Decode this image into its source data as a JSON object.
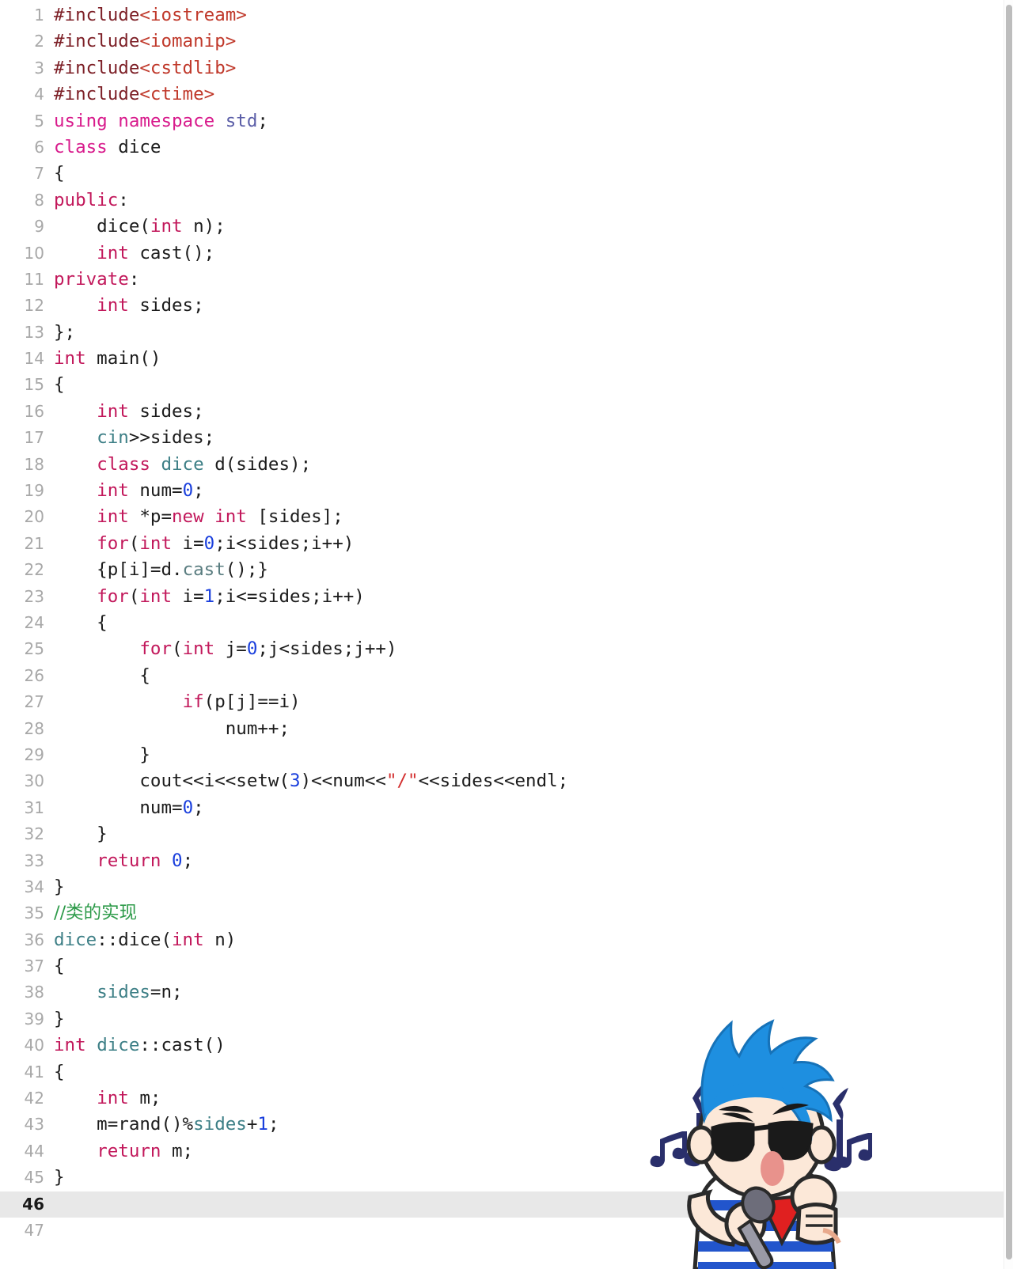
{
  "editor": {
    "language": "C++",
    "active_line": 46,
    "total_visible_lines": 47,
    "colors": {
      "background": "#ffffff",
      "active_line_bg": "#e8e8e8",
      "gutter_text": "#a8a8a8",
      "preprocessor": "#7d2027",
      "header_name": "#c0392b",
      "keyword": "#c2185b",
      "keyword_using": "#d81b8c",
      "type_name": "#3d7f86",
      "namespace": "#5c5fa8",
      "number": "#1a3fdd",
      "string": "#d32f2f",
      "comment": "#2e9b4a",
      "plain_text": "#1c1c1c",
      "scrollbar_thumb": "#bdbdbd"
    }
  },
  "scrollbar": {
    "name": "vertical-scrollbar",
    "orientation": "vertical",
    "position_percent": 0
  },
  "mascot": {
    "name": "cartoon-singer-overlay",
    "description": "blue pompadour boy with sunglasses singing into microphone",
    "hair_color": "#1e8fe0",
    "shirt_stripe_color": "#2255cc",
    "bandana_color": "#e02020",
    "note_color": "#2a2f6b",
    "skin_color": "#fce8d8"
  },
  "code": {
    "lines": [
      {
        "n": "1",
        "tokens": [
          {
            "c": "t-pre",
            "t": "#include"
          },
          {
            "c": "t-header",
            "t": "<iostream>"
          }
        ]
      },
      {
        "n": "2",
        "tokens": [
          {
            "c": "t-pre",
            "t": "#include"
          },
          {
            "c": "t-header",
            "t": "<iomanip>"
          }
        ]
      },
      {
        "n": "3",
        "tokens": [
          {
            "c": "t-pre",
            "t": "#include"
          },
          {
            "c": "t-header",
            "t": "<cstdlib>"
          }
        ]
      },
      {
        "n": "4",
        "tokens": [
          {
            "c": "t-pre",
            "t": "#include"
          },
          {
            "c": "t-header",
            "t": "<ctime>"
          }
        ]
      },
      {
        "n": "5",
        "tokens": [
          {
            "c": "t-kw2",
            "t": "using namespace "
          },
          {
            "c": "t-ns",
            "t": "std"
          },
          {
            "c": "t-plain",
            "t": ";"
          }
        ]
      },
      {
        "n": "6",
        "tokens": [
          {
            "c": "t-kw2",
            "t": "class"
          },
          {
            "c": "t-plain",
            "t": " dice"
          }
        ]
      },
      {
        "n": "7",
        "tokens": [
          {
            "c": "t-plain",
            "t": "{"
          }
        ]
      },
      {
        "n": "8",
        "tokens": [
          {
            "c": "t-kw",
            "t": "public"
          },
          {
            "c": "t-plain",
            "t": ":"
          }
        ]
      },
      {
        "n": "9",
        "tokens": [
          {
            "c": "t-plain",
            "t": "    dice("
          },
          {
            "c": "t-kw",
            "t": "int"
          },
          {
            "c": "t-plain",
            "t": " n);"
          }
        ]
      },
      {
        "n": "10",
        "tokens": [
          {
            "c": "t-plain",
            "t": "    "
          },
          {
            "c": "t-kw",
            "t": "int"
          },
          {
            "c": "t-plain",
            "t": " cast();"
          }
        ]
      },
      {
        "n": "11",
        "tokens": [
          {
            "c": "t-kw",
            "t": "private"
          },
          {
            "c": "t-plain",
            "t": ":"
          }
        ]
      },
      {
        "n": "12",
        "tokens": [
          {
            "c": "t-plain",
            "t": "    "
          },
          {
            "c": "t-kw",
            "t": "int"
          },
          {
            "c": "t-plain",
            "t": " sides;"
          }
        ]
      },
      {
        "n": "13",
        "tokens": [
          {
            "c": "t-plain",
            "t": "};"
          }
        ]
      },
      {
        "n": "14",
        "tokens": [
          {
            "c": "t-kw",
            "t": "int"
          },
          {
            "c": "t-plain",
            "t": " main()"
          }
        ]
      },
      {
        "n": "15",
        "tokens": [
          {
            "c": "t-plain",
            "t": "{"
          }
        ]
      },
      {
        "n": "16",
        "tokens": [
          {
            "c": "t-plain",
            "t": "    "
          },
          {
            "c": "t-kw",
            "t": "int"
          },
          {
            "c": "t-plain",
            "t": " sides;"
          }
        ]
      },
      {
        "n": "17",
        "tokens": [
          {
            "c": "t-plain",
            "t": "    "
          },
          {
            "c": "t-type",
            "t": "cin"
          },
          {
            "c": "t-plain",
            "t": ">>sides;"
          }
        ]
      },
      {
        "n": "18",
        "tokens": [
          {
            "c": "t-plain",
            "t": "    "
          },
          {
            "c": "t-kw",
            "t": "class"
          },
          {
            "c": "t-plain",
            "t": " "
          },
          {
            "c": "t-type",
            "t": "dice"
          },
          {
            "c": "t-plain",
            "t": " d(sides);"
          }
        ]
      },
      {
        "n": "19",
        "tokens": [
          {
            "c": "t-plain",
            "t": "    "
          },
          {
            "c": "t-kw",
            "t": "int"
          },
          {
            "c": "t-plain",
            "t": " num="
          },
          {
            "c": "t-num",
            "t": "0"
          },
          {
            "c": "t-plain",
            "t": ";"
          }
        ]
      },
      {
        "n": "20",
        "tokens": [
          {
            "c": "t-plain",
            "t": "    "
          },
          {
            "c": "t-kw",
            "t": "int"
          },
          {
            "c": "t-plain",
            "t": " *p="
          },
          {
            "c": "t-kw",
            "t": "new"
          },
          {
            "c": "t-plain",
            "t": " "
          },
          {
            "c": "t-kw",
            "t": "int"
          },
          {
            "c": "t-plain",
            "t": " [sides];"
          }
        ]
      },
      {
        "n": "21",
        "tokens": [
          {
            "c": "t-plain",
            "t": "    "
          },
          {
            "c": "t-kw",
            "t": "for"
          },
          {
            "c": "t-plain",
            "t": "("
          },
          {
            "c": "t-kw",
            "t": "int"
          },
          {
            "c": "t-plain",
            "t": " i="
          },
          {
            "c": "t-num",
            "t": "0"
          },
          {
            "c": "t-plain",
            "t": ";i<sides;i++)"
          }
        ]
      },
      {
        "n": "22",
        "tokens": [
          {
            "c": "t-plain",
            "t": "    {p[i]=d."
          },
          {
            "c": "t-fn",
            "t": "cast"
          },
          {
            "c": "t-plain",
            "t": "();}"
          }
        ]
      },
      {
        "n": "23",
        "tokens": [
          {
            "c": "t-plain",
            "t": "    "
          },
          {
            "c": "t-kw",
            "t": "for"
          },
          {
            "c": "t-plain",
            "t": "("
          },
          {
            "c": "t-kw",
            "t": "int"
          },
          {
            "c": "t-plain",
            "t": " i="
          },
          {
            "c": "t-num",
            "t": "1"
          },
          {
            "c": "t-plain",
            "t": ";i<=sides;i++)"
          }
        ]
      },
      {
        "n": "24",
        "tokens": [
          {
            "c": "t-plain",
            "t": "    {"
          }
        ]
      },
      {
        "n": "25",
        "tokens": [
          {
            "c": "t-plain",
            "t": "        "
          },
          {
            "c": "t-kw",
            "t": "for"
          },
          {
            "c": "t-plain",
            "t": "("
          },
          {
            "c": "t-kw",
            "t": "int"
          },
          {
            "c": "t-plain",
            "t": " j="
          },
          {
            "c": "t-num",
            "t": "0"
          },
          {
            "c": "t-plain",
            "t": ";j<sides;j++)"
          }
        ]
      },
      {
        "n": "26",
        "tokens": [
          {
            "c": "t-plain",
            "t": "        {"
          }
        ]
      },
      {
        "n": "27",
        "tokens": [
          {
            "c": "t-plain",
            "t": "            "
          },
          {
            "c": "t-kw",
            "t": "if"
          },
          {
            "c": "t-plain",
            "t": "(p[j]==i)"
          }
        ]
      },
      {
        "n": "28",
        "tokens": [
          {
            "c": "t-plain",
            "t": "                num++;"
          }
        ]
      },
      {
        "n": "29",
        "tokens": [
          {
            "c": "t-plain",
            "t": "        }"
          }
        ]
      },
      {
        "n": "30",
        "tokens": [
          {
            "c": "t-plain",
            "t": "        cout<<i<<setw("
          },
          {
            "c": "t-num",
            "t": "3"
          },
          {
            "c": "t-plain",
            "t": ")<<num<<"
          },
          {
            "c": "t-str",
            "t": "\"/\""
          },
          {
            "c": "t-plain",
            "t": "<<sides<<endl;"
          }
        ]
      },
      {
        "n": "31",
        "tokens": [
          {
            "c": "t-plain",
            "t": "        num="
          },
          {
            "c": "t-num",
            "t": "0"
          },
          {
            "c": "t-plain",
            "t": ";"
          }
        ]
      },
      {
        "n": "32",
        "tokens": [
          {
            "c": "t-plain",
            "t": "    }"
          }
        ]
      },
      {
        "n": "33",
        "tokens": [
          {
            "c": "t-plain",
            "t": "    "
          },
          {
            "c": "t-kw",
            "t": "return"
          },
          {
            "c": "t-plain",
            "t": " "
          },
          {
            "c": "t-num",
            "t": "0"
          },
          {
            "c": "t-plain",
            "t": ";"
          }
        ]
      },
      {
        "n": "34",
        "tokens": [
          {
            "c": "t-plain",
            "t": "}"
          }
        ]
      },
      {
        "n": "35",
        "tokens": [
          {
            "c": "t-cmt cjk",
            "t": "//类的实现"
          }
        ]
      },
      {
        "n": "36",
        "tokens": [
          {
            "c": "t-type",
            "t": "dice"
          },
          {
            "c": "t-plain",
            "t": "::dice("
          },
          {
            "c": "t-kw",
            "t": "int"
          },
          {
            "c": "t-plain",
            "t": " n)"
          }
        ]
      },
      {
        "n": "37",
        "tokens": [
          {
            "c": "t-plain",
            "t": "{"
          }
        ]
      },
      {
        "n": "38",
        "tokens": [
          {
            "c": "t-plain",
            "t": "    "
          },
          {
            "c": "t-type",
            "t": "sides"
          },
          {
            "c": "t-plain",
            "t": "=n;"
          }
        ]
      },
      {
        "n": "39",
        "tokens": [
          {
            "c": "t-plain",
            "t": "}"
          }
        ]
      },
      {
        "n": "40",
        "tokens": [
          {
            "c": "t-kw",
            "t": "int"
          },
          {
            "c": "t-plain",
            "t": " "
          },
          {
            "c": "t-type",
            "t": "dice"
          },
          {
            "c": "t-plain",
            "t": "::cast()"
          }
        ]
      },
      {
        "n": "41",
        "tokens": [
          {
            "c": "t-plain",
            "t": "{"
          }
        ]
      },
      {
        "n": "42",
        "tokens": [
          {
            "c": "t-plain",
            "t": "    "
          },
          {
            "c": "t-kw",
            "t": "int"
          },
          {
            "c": "t-plain",
            "t": " m;"
          }
        ]
      },
      {
        "n": "43",
        "tokens": [
          {
            "c": "t-plain",
            "t": "    m=rand()%"
          },
          {
            "c": "t-type",
            "t": "sides"
          },
          {
            "c": "t-plain",
            "t": "+"
          },
          {
            "c": "t-num",
            "t": "1"
          },
          {
            "c": "t-plain",
            "t": ";"
          }
        ]
      },
      {
        "n": "44",
        "tokens": [
          {
            "c": "t-plain",
            "t": "    "
          },
          {
            "c": "t-kw",
            "t": "return"
          },
          {
            "c": "t-plain",
            "t": " m;"
          }
        ]
      },
      {
        "n": "45",
        "tokens": [
          {
            "c": "t-plain",
            "t": "}"
          }
        ]
      },
      {
        "n": "46",
        "tokens": [],
        "active": true
      },
      {
        "n": "47",
        "tokens": []
      }
    ]
  }
}
